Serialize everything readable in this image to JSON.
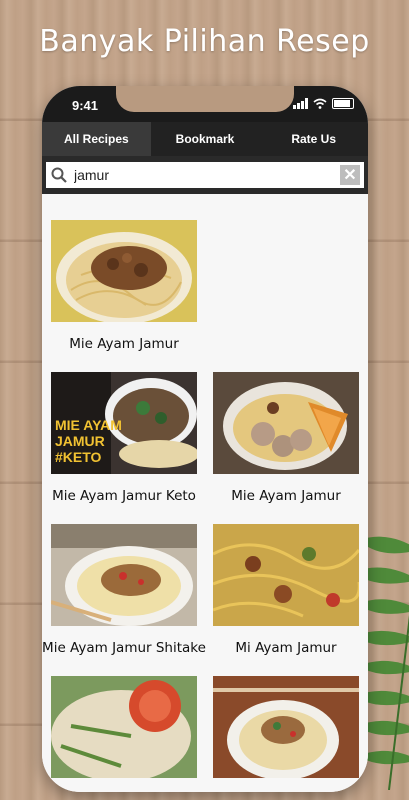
{
  "headline": "Banyak Pilihan Resep",
  "status_bar": {
    "time": "9:41"
  },
  "tabs": [
    {
      "label": "All Recipes",
      "active": true
    },
    {
      "label": "Bookmark",
      "active": false
    },
    {
      "label": "Rate Us",
      "active": false
    }
  ],
  "search": {
    "value": "jamur",
    "clear_icon": "close-icon"
  },
  "recipes": [
    {
      "title": "Mie Ayam Jamur"
    },
    {
      "title": "Mie Ayam Jamur Keto",
      "image_text": "MIE AYAM JAMUR #KETO"
    },
    {
      "title": "Mie Ayam Jamur"
    },
    {
      "title": "Mie Ayam Jamur Shitake"
    },
    {
      "title": "Mi Ayam Jamur"
    },
    {
      "title": ""
    },
    {
      "title": ""
    }
  ],
  "colors": {
    "accent_dark": "#222222",
    "active_tab": "#3a3a3a",
    "background_wood": "#c4a58c"
  }
}
